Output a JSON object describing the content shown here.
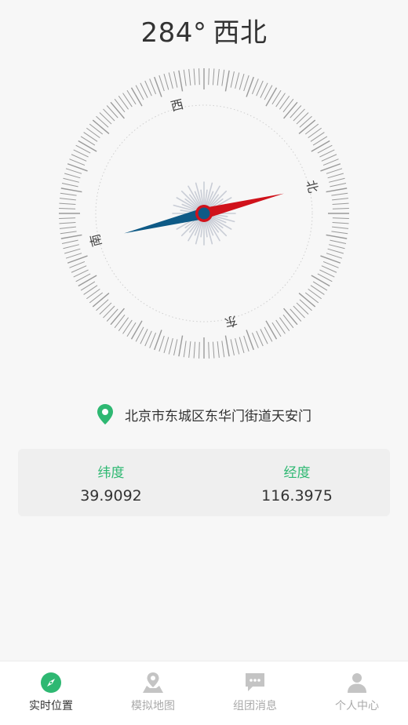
{
  "header": {
    "degrees": "284°",
    "direction": "西北"
  },
  "compass": {
    "labels": {
      "west": "西",
      "north": "北",
      "south": "南",
      "east": "东"
    },
    "heading_deg": 284,
    "colors": {
      "north_needle": "#d0121b",
      "south_needle": "#0e5a86",
      "ticks": "#9a9a9a"
    }
  },
  "location": {
    "address": "北京市东城区东华门街道天安门",
    "pin_color": "#2eb872"
  },
  "coords": {
    "latitude_label": "纬度",
    "latitude_value": "39.9092",
    "longitude_label": "经度",
    "longitude_value": "116.3975"
  },
  "tabs": [
    {
      "label": "实时位置",
      "icon": "compass-icon",
      "active": true
    },
    {
      "label": "模拟地图",
      "icon": "map-icon",
      "active": false
    },
    {
      "label": "组团消息",
      "icon": "chat-icon",
      "active": false
    },
    {
      "label": "个人中心",
      "icon": "user-icon",
      "active": false
    }
  ]
}
